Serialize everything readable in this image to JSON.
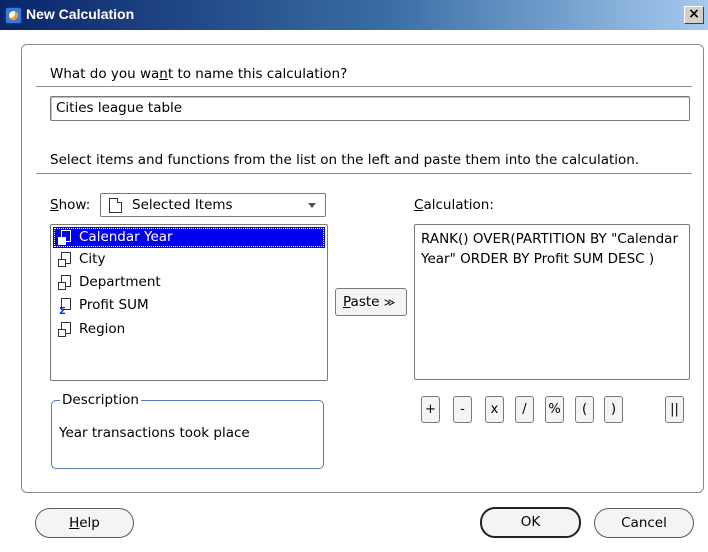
{
  "window": {
    "title": "New Calculation",
    "close_label": "×"
  },
  "name_section": {
    "prompt_before": "What do you wa",
    "prompt_mnemonic": "n",
    "prompt_after": "t to name this calculation?",
    "value": "Cities league table"
  },
  "instructions": "Select items and functions from the list on the left and paste them into the calculation.",
  "show": {
    "label_mnemonic": "S",
    "label_rest": "how:",
    "selected": "Selected Items"
  },
  "items": [
    {
      "label": "Calendar Year",
      "icon": "dimension-item-icon",
      "selected": true
    },
    {
      "label": "City",
      "icon": "dimension-item-icon",
      "selected": false
    },
    {
      "label": "Department",
      "icon": "dimension-item-icon",
      "selected": false
    },
    {
      "label": "Profit SUM",
      "icon": "measure-sum-icon",
      "selected": false
    },
    {
      "label": "Region",
      "icon": "dimension-item-icon",
      "selected": false
    }
  ],
  "paste": {
    "mnemonic": "P",
    "rest": "aste",
    "arrow": "≫"
  },
  "calculation": {
    "label_mnemonic": "C",
    "label_rest": "alculation:",
    "text": "RANK() OVER(PARTITION BY \"Calendar Year\" ORDER BY Profit SUM DESC )"
  },
  "operators": [
    "+",
    "-",
    "x",
    "/",
    "%",
    "(",
    ")",
    "||"
  ],
  "description": {
    "legend": "Description",
    "text": "Year transactions took place"
  },
  "buttons": {
    "help_mnemonic": "H",
    "help_rest": "elp",
    "ok": "OK",
    "cancel": "Cancel"
  }
}
